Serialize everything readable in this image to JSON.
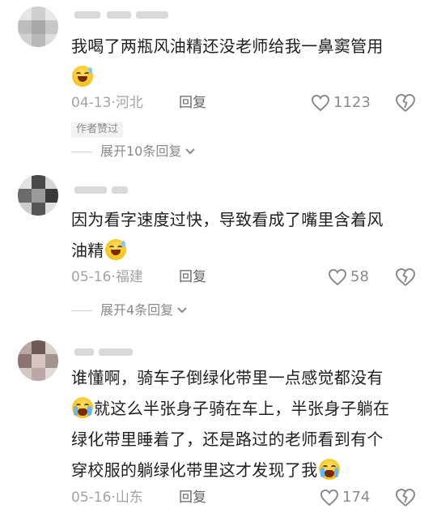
{
  "comments": [
    {
      "text": "我喝了两瓶风油精还没老师给我一鼻窦管用",
      "emoji": "grinning-sweat-emoji",
      "date": "04-13",
      "location": "河北",
      "reply_label": "回复",
      "likes": "1123",
      "author_badge": "作者赞过",
      "expand_label": "展开10条回复"
    },
    {
      "text_line1": "因为看字速度过快，导致看成了嘴里含着风",
      "text_line2": "油精",
      "emoji": "grinning-sweat-emoji",
      "date": "05-16",
      "location": "福建",
      "reply_label": "回复",
      "likes": "58",
      "expand_label": "展开4条回复"
    },
    {
      "text_line1": "谁懂啊，骑车子倒绿化带里一点感觉都没有",
      "text_line2": "就这么半张身子骑在车上，半张身子躺在",
      "text_line3": "绿化带里睡着了，还是路过的老师看到有个",
      "text_line4": "穿校服的躺绿化带里这才发现了我",
      "emoji": "loudly-crying-emoji",
      "date": "05-16",
      "location": "山东",
      "reply_label": "回复",
      "likes": "174"
    }
  ],
  "separator": " · ",
  "colors": {
    "text": "#1f1f1f",
    "meta": "#a3a3a3",
    "icon": "#8a8a8a",
    "badge_bg": "#f2f2f2"
  }
}
